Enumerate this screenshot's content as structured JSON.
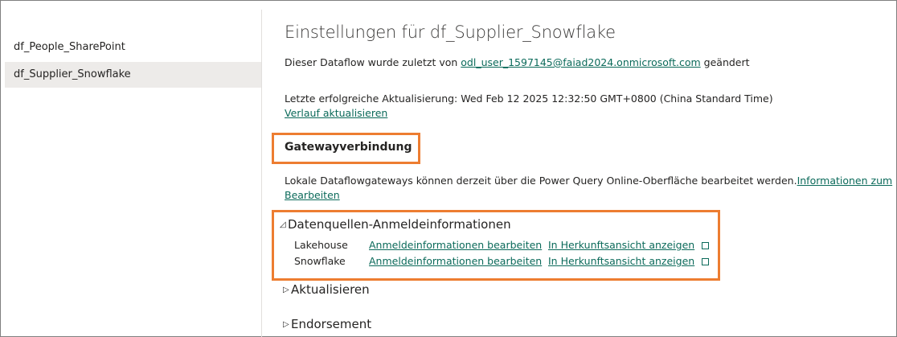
{
  "sidebar": {
    "items": [
      {
        "label": "df_People_SharePoint"
      },
      {
        "label": "df_Supplier_Snowflake"
      }
    ]
  },
  "main": {
    "title": "Einstellungen für df_Supplier_Snowflake",
    "modified_prefix": "Dieser Dataflow wurde zuletzt von ",
    "modified_user": "odl_user_1597145@faiad2024.onmicrosoft.com",
    "modified_suffix": " geändert",
    "last_refresh": "Letzte erfolgreiche Aktualisierung: Wed Feb 12 2025 12:32:50 GMT+0800 (China Standard Time)",
    "refresh_history_link": "Verlauf aktualisieren",
    "gateway": {
      "heading": "Gatewayverbindung",
      "description": "Lokale Dataflowgateways können derzeit über die Power Query Online-Oberfläche bearbeitet werden.",
      "info_link_part1": "Informationen zum",
      "info_link_part2": "Bearbeiten"
    },
    "datasource_credentials": {
      "label": "Datenquellen-Anmeldeinformationen",
      "rows": [
        {
          "source": "Lakehouse",
          "edit_link": "Anmeldeinformationen bearbeiten",
          "lineage_link": "In Herkunftsansicht anzeigen"
        },
        {
          "source": "Snowflake",
          "edit_link": "Anmeldeinformationen bearbeiten",
          "lineage_link": "In Herkunftsansicht anzeigen"
        }
      ]
    },
    "sections": [
      {
        "label": "Aktualisieren"
      },
      {
        "label": "Endorsement"
      }
    ]
  },
  "colors": {
    "highlight_border": "#ed7d31",
    "link": "#0b6a5a",
    "selected_bg": "#edebe9"
  },
  "icons": {
    "expanded": "triangle-down-right-icon",
    "collapsed": "triangle-right-icon",
    "external": "external-link-icon"
  }
}
